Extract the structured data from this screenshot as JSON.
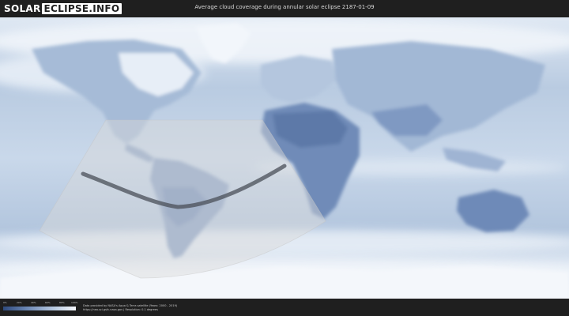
{
  "header": {
    "logo_part1": "SOLAR",
    "logo_part2": "ECLIPSE.INFO",
    "title": "Average cloud coverage during annular solar eclipse 2187-01-09"
  },
  "legend": {
    "ticks": [
      "0%",
      "20%",
      "40%",
      "60%",
      "80%",
      "100%"
    ],
    "colors": {
      "low_cover": "#2e4a7c",
      "high_cover": "#f4f7fb"
    }
  },
  "footer": {
    "credit_line1": "Data provided by NASA's Aqua & Terra satellite (Years: 2000 - 2019)",
    "credit_line2": "https://neo.sci.gsfc.nasa.gov | Resolution: 0.1 degrees"
  },
  "map": {
    "colors": {
      "ocean": "#c3d3e6",
      "land_clear": "#5f7aa8",
      "cloud": "#eef3f9",
      "penumbra": "#d9d9d9",
      "central_path": "#4a4f58"
    },
    "icons": [
      "eclipse-path",
      "penumbra-shadow"
    ]
  }
}
